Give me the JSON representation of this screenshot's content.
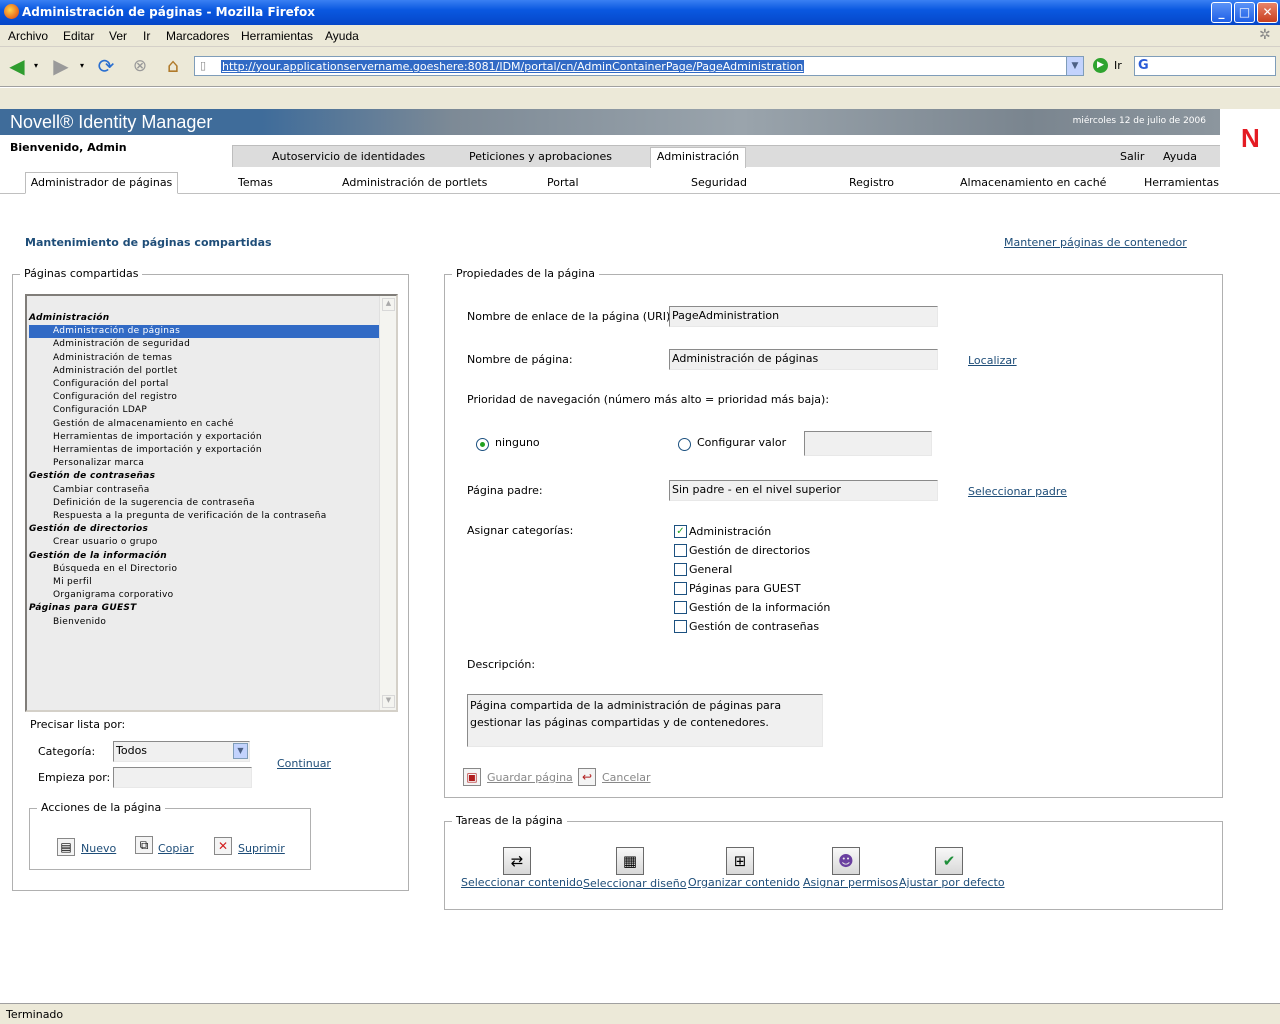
{
  "window": {
    "title": "Administración de páginas - Mozilla Firefox",
    "min": "_",
    "max": "□",
    "close": "✕"
  },
  "menu": [
    "Archivo",
    "Editar",
    "Ver",
    "Ir",
    "Marcadores",
    "Herramientas",
    "Ayuda"
  ],
  "toolbar": {
    "url": "http://your.applicationservername.goeshere:8081/IDM/portal/cn/AdminContainerPage/PageAdministration",
    "go_label": "Ir",
    "search_glyph": "G"
  },
  "app": {
    "brand": "Novell® Identity Manager",
    "date": "miércoles 12 de julio de 2006",
    "welcome": "Bienvenido, Admin",
    "logo": "N"
  },
  "tabs": [
    "Autoservicio de identidades",
    "Peticiones y aprobaciones",
    "Administración"
  ],
  "top_links": [
    "Salir",
    "Ayuda"
  ],
  "subnav": [
    "Administrador de páginas",
    "Temas",
    "Administración de portlets",
    "Portal",
    "Seguridad",
    "Registro",
    "Almacenamiento en caché",
    "Herramientas"
  ],
  "page": {
    "title": "Mantenimiento de páginas compartidas",
    "maintain_link": "Mantener páginas de contenedor"
  },
  "shared": {
    "legend": "Páginas compartidas",
    "list": [
      {
        "t": "Administración",
        "h": true
      },
      {
        "t": "Administración de páginas",
        "sel": true
      },
      {
        "t": "Administración de seguridad"
      },
      {
        "t": "Administración de temas"
      },
      {
        "t": "Administración del portlet"
      },
      {
        "t": "Configuración del portal"
      },
      {
        "t": "Configuración del registro"
      },
      {
        "t": "Configuración LDAP"
      },
      {
        "t": "Gestión de almacenamiento en caché"
      },
      {
        "t": "Herramientas de importación y exportación"
      },
      {
        "t": "Herramientas de importación y exportación"
      },
      {
        "t": "Personalizar marca"
      },
      {
        "t": "Gestión de contraseñas",
        "h": true
      },
      {
        "t": "Cambiar contraseña"
      },
      {
        "t": "Definición de la sugerencia de contraseña"
      },
      {
        "t": "Respuesta a la pregunta de verificación de la contraseña"
      },
      {
        "t": "Gestión de directorios",
        "h": true
      },
      {
        "t": "Crear usuario o grupo"
      },
      {
        "t": "Gestión de la información",
        "h": true
      },
      {
        "t": "Búsqueda en el Directorio"
      },
      {
        "t": "Mi perfil"
      },
      {
        "t": "Organigrama corporativo"
      },
      {
        "t": "Páginas para GUEST",
        "h": true
      },
      {
        "t": "Bienvenido"
      }
    ],
    "refine_label": "Precisar lista por:",
    "category_label": "Categoría:",
    "category_value": "Todos",
    "starts_label": "Empieza por:",
    "starts_value": "",
    "continue_link": "Continuar",
    "actions_legend": "Acciones de la página",
    "actions": [
      "Nuevo",
      "Copiar",
      "Suprimir"
    ]
  },
  "props": {
    "legend": "Propiedades de la página",
    "uri_label": "Nombre de enlace de la página (URI):",
    "uri_value": "PageAdministration",
    "name_label": "Nombre de página:",
    "name_value": "Administración de páginas",
    "localize_link": "Localizar",
    "priority_label": "Prioridad de navegación (número más alto = prioridad más baja):",
    "radio_none": "ninguno",
    "radio_value": "Configurar valor",
    "value_field": "",
    "parent_label": "Página padre:",
    "parent_value": "Sin padre - en el nivel superior",
    "parent_link": "Seleccionar padre",
    "categories_label": "Asignar categorías:",
    "categories": [
      {
        "t": "Administración",
        "checked": true
      },
      {
        "t": "Gestión de directorios",
        "checked": false
      },
      {
        "t": "General",
        "checked": false
      },
      {
        "t": "Páginas para GUEST",
        "checked": false
      },
      {
        "t": "Gestión de la información",
        "checked": false
      },
      {
        "t": "Gestión de contraseñas",
        "checked": false
      }
    ],
    "desc_label": "Descripción:",
    "desc_value": "Página compartida de la administración de páginas para gestionar las páginas compartidas y de contenedores.",
    "save": "Guardar página",
    "cancel": "Cancelar"
  },
  "tasks": {
    "legend": "Tareas de la página",
    "items": [
      "Seleccionar contenido",
      "Seleccionar diseño",
      "Organizar contenido",
      "Asignar permisos",
      "Ajustar por defecto"
    ]
  },
  "status": "Terminado"
}
